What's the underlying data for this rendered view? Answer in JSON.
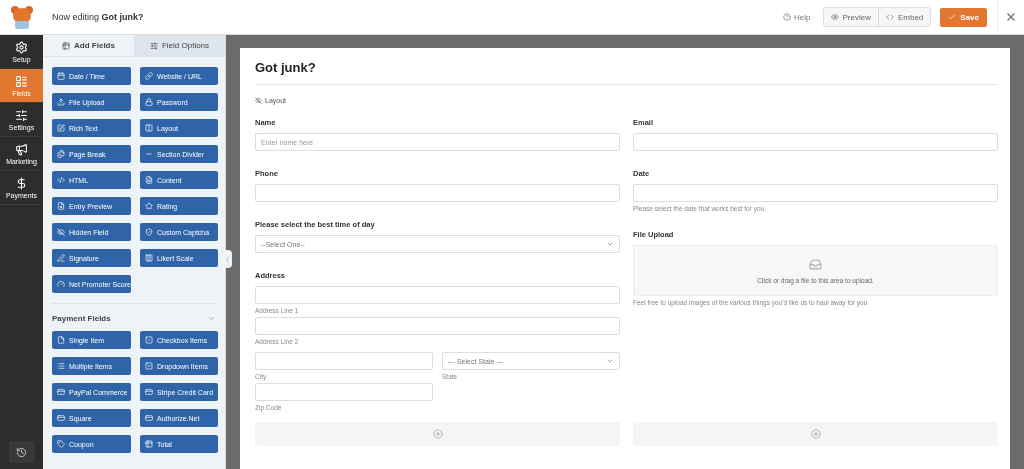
{
  "topbar": {
    "prefix": "Now editing",
    "form_name": "Got junk?",
    "help": "Help",
    "preview": "Preview",
    "embed": "Embed",
    "save": "Save"
  },
  "nav": [
    {
      "label": "Setup",
      "selected": false
    },
    {
      "label": "Fields",
      "selected": true
    },
    {
      "label": "Settings",
      "selected": false
    },
    {
      "label": "Marketing",
      "selected": false
    },
    {
      "label": "Payments",
      "selected": false
    }
  ],
  "panel_tabs": [
    {
      "label": "Add Fields",
      "selected": true
    },
    {
      "label": "Field Options",
      "selected": false
    }
  ],
  "fancy_fields": [
    "Date / Time",
    "Website / URL",
    "File Upload",
    "Password",
    "Rich Text",
    "Layout",
    "Page Break",
    "Section Divider",
    "HTML",
    "Content",
    "Entry Preview",
    "Rating",
    "Hidden Field",
    "Custom Captcha",
    "Signature",
    "Likert Scale",
    "Net Promoter Score"
  ],
  "payment_section": {
    "title": "Payment Fields",
    "expanded": true,
    "fields": [
      "Single Item",
      "Checkbox Items",
      "Multiple Items",
      "Dropdown Items",
      "PayPal Commerce",
      "Stripe Credit Card",
      "Square",
      "Authorize.Net",
      "Coupon",
      "Total"
    ]
  },
  "form": {
    "title": "Got junk?",
    "layout_label": "Layout",
    "left": [
      {
        "kind": "text",
        "label": "Name",
        "placeholder": "Enter name here"
      },
      {
        "kind": "text",
        "label": "Phone"
      },
      {
        "kind": "select",
        "label": "Please select the best time of day",
        "value": "--Select One--"
      },
      {
        "kind": "address",
        "label": "Address",
        "line1": "Address Line 1",
        "line2": "Address Line 2",
        "city": "City",
        "state_value": "--- Select State ---",
        "state": "State",
        "zip": "Zip Code"
      }
    ],
    "right": [
      {
        "kind": "text",
        "label": "Email"
      },
      {
        "kind": "text",
        "label": "Date",
        "description": "Please select the date that works best for you."
      },
      {
        "kind": "upload",
        "label": "File Upload",
        "prompt": "Click or drag a file to this area to upload.",
        "description": "Feel free to upload images of the various things you'd like us to haul away for you"
      }
    ]
  }
}
